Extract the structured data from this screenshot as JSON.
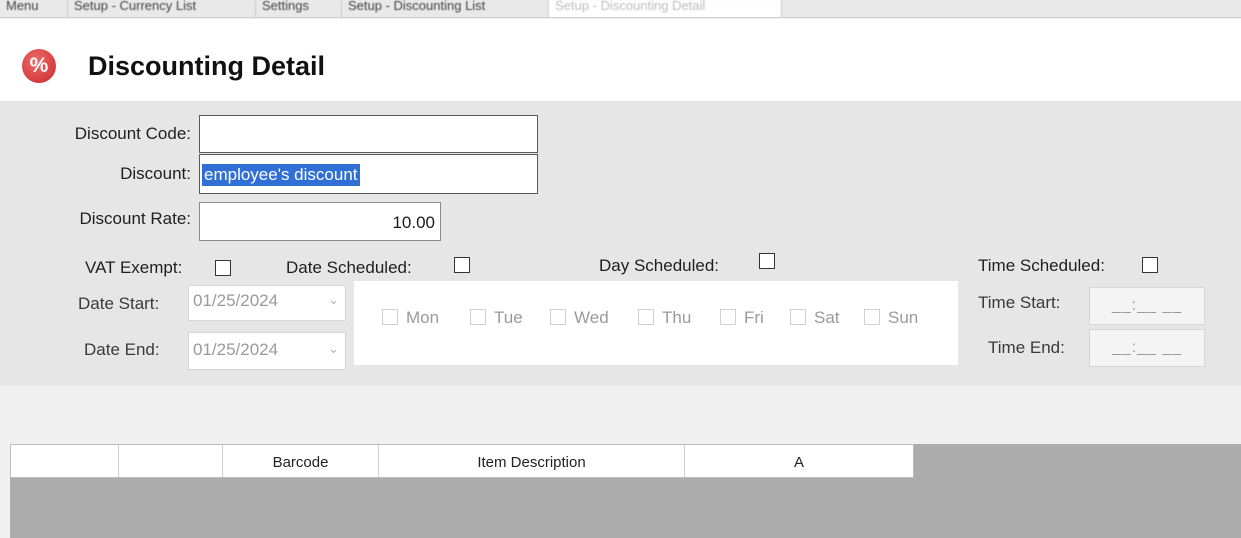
{
  "tabs": [
    {
      "label": "Menu"
    },
    {
      "label": "Setup - Currency List"
    },
    {
      "label": "Settings"
    },
    {
      "label": "Setup - Discounting List"
    },
    {
      "label": "Setup - Discounting Detail"
    }
  ],
  "header": {
    "icon": "percent-icon",
    "icon_glyph": "%",
    "title": "Discounting Detail",
    "icon_color": "#d93838"
  },
  "form": {
    "discount_code": {
      "label": "Discount Code:",
      "value": ""
    },
    "discount": {
      "label": "Discount:",
      "value": "employee's discount"
    },
    "discount_rate": {
      "label": "Discount Rate:",
      "value": "10.00"
    },
    "vat_exempt": {
      "label": "VAT Exempt:",
      "checked": false
    },
    "date_scheduled": {
      "label": "Date Scheduled:",
      "checked": false
    },
    "day_scheduled": {
      "label": "Day Scheduled:",
      "checked": false
    },
    "time_scheduled": {
      "label": "Time Scheduled:",
      "checked": false
    },
    "date_start": {
      "label": "Date Start:",
      "value": "01/25/2024"
    },
    "date_end": {
      "label": "Date End:",
      "value": "01/25/2024"
    },
    "time_start": {
      "label": "Time Start:",
      "value": "__:__ __"
    },
    "time_end": {
      "label": "Time End:",
      "value": "__:__ __"
    },
    "days": [
      {
        "label": "Mon",
        "checked": false
      },
      {
        "label": "Tue",
        "checked": false
      },
      {
        "label": "Wed",
        "checked": false
      },
      {
        "label": "Thu",
        "checked": false
      },
      {
        "label": "Fri",
        "checked": false
      },
      {
        "label": "Sat",
        "checked": false
      },
      {
        "label": "Sun",
        "checked": false
      }
    ]
  },
  "grid": {
    "columns": [
      "",
      "",
      "Barcode",
      "Item Description",
      "A"
    ]
  },
  "colors": {
    "selection": "#2f6fd6",
    "panel": "#e6e6e6",
    "grid_bg": "#acacac"
  }
}
